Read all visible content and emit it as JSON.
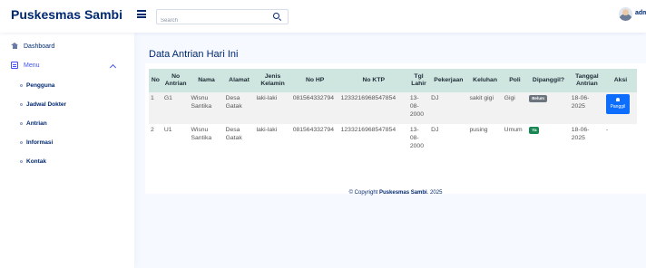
{
  "header": {
    "brand": "Puskesmas Sambi",
    "search_placeholder": "Search",
    "user": "admi"
  },
  "sidebar": {
    "dashboard": "Dashboard",
    "menu": "Menu",
    "sub_items": [
      "Pengguna",
      "Jadwal Dokter",
      "Antrian",
      "Informasi",
      "Kontak"
    ]
  },
  "main": {
    "title": "Data Antrian Hari Ini",
    "columns": [
      "No",
      "No Antrian",
      "Nama",
      "Alamat",
      "Jenis Kelamin",
      "No HP",
      "No KTP",
      "Tgl Lahir",
      "Pekerjaan",
      "Keluhan",
      "Poli",
      "Dipanggil?",
      "Tanggal Antrian",
      "Aksi"
    ],
    "rows": [
      {
        "no": "1",
        "antrian": "G1",
        "nama": "Wisnu Santika",
        "alamat": "Desa Gatak",
        "jk": "laki-laki",
        "hp": "081564332794",
        "ktp": "1233216968547854",
        "tgl": "13-08-2000",
        "kerja": "DJ",
        "keluhan": "sakit gigi",
        "poli": "Gigi",
        "status": "Belum",
        "tanggal": "18-06-2025",
        "aksi": "Panggil"
      },
      {
        "no": "2",
        "antrian": "U1",
        "nama": "Wisnu Santika",
        "alamat": "Desa Gatak",
        "jk": "laki-laki",
        "hp": "081564332794",
        "ktp": "1233216968547854",
        "tgl": "13-08-2000",
        "kerja": "DJ",
        "keluhan": "pusing",
        "poli": "Umum",
        "status": "Ya",
        "tanggal": "18-06-2025",
        "aksi": "-"
      }
    ]
  },
  "footer": {
    "prefix": "© Copyright ",
    "brand": "Puskesmas Sambi",
    "suffix": ". 2025"
  },
  "colors": {
    "navy": "#012970",
    "blue": "#4154f1",
    "header_row": "#cfe5df",
    "button": "#0d6efd",
    "badge_yes": "#198754",
    "badge_no": "#6c757d"
  }
}
